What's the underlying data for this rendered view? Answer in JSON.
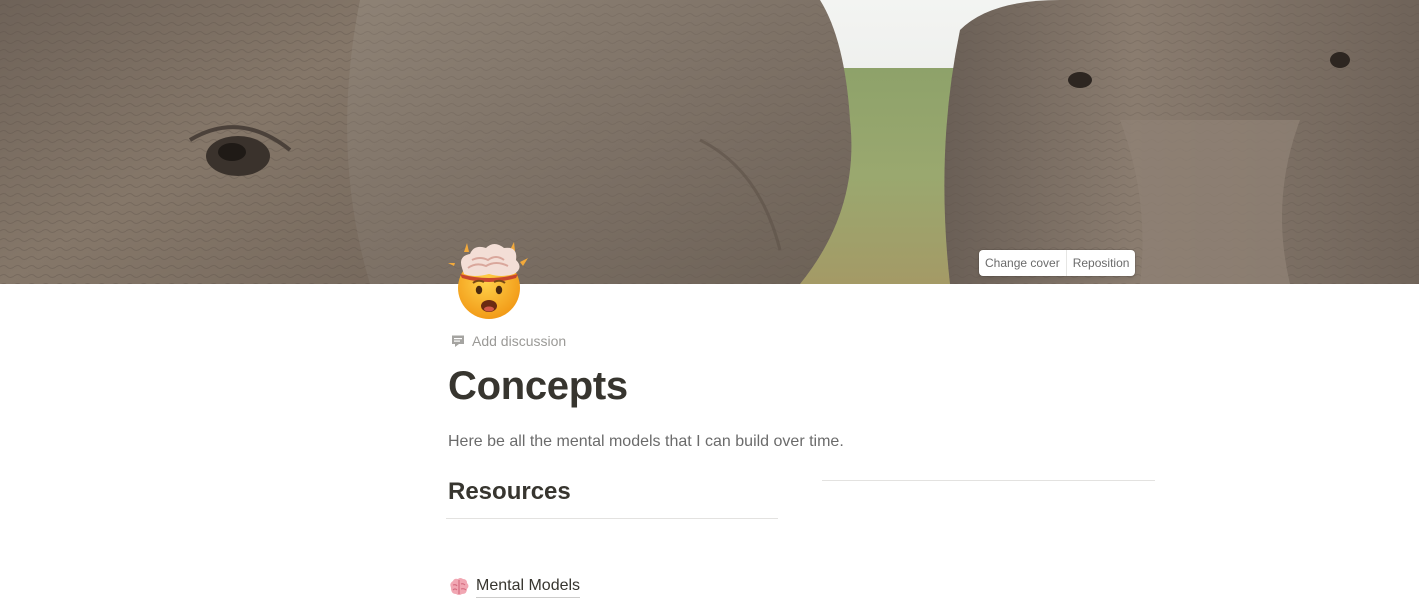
{
  "cover": {
    "change_cover_label": "Change cover",
    "reposition_label": "Reposition"
  },
  "page": {
    "icon": "exploding-head-emoji",
    "add_discussion_label": "Add discussion",
    "title": "Concepts",
    "description": "Here be all the mental models that I can build over time."
  },
  "sections": {
    "resources_heading": "Resources"
  },
  "links": [
    {
      "icon": "brain-emoji",
      "label": "Mental Models"
    }
  ],
  "colors": {
    "text": "#37352f",
    "muted": "#9b9a97",
    "divider": "#e3e2e0"
  }
}
